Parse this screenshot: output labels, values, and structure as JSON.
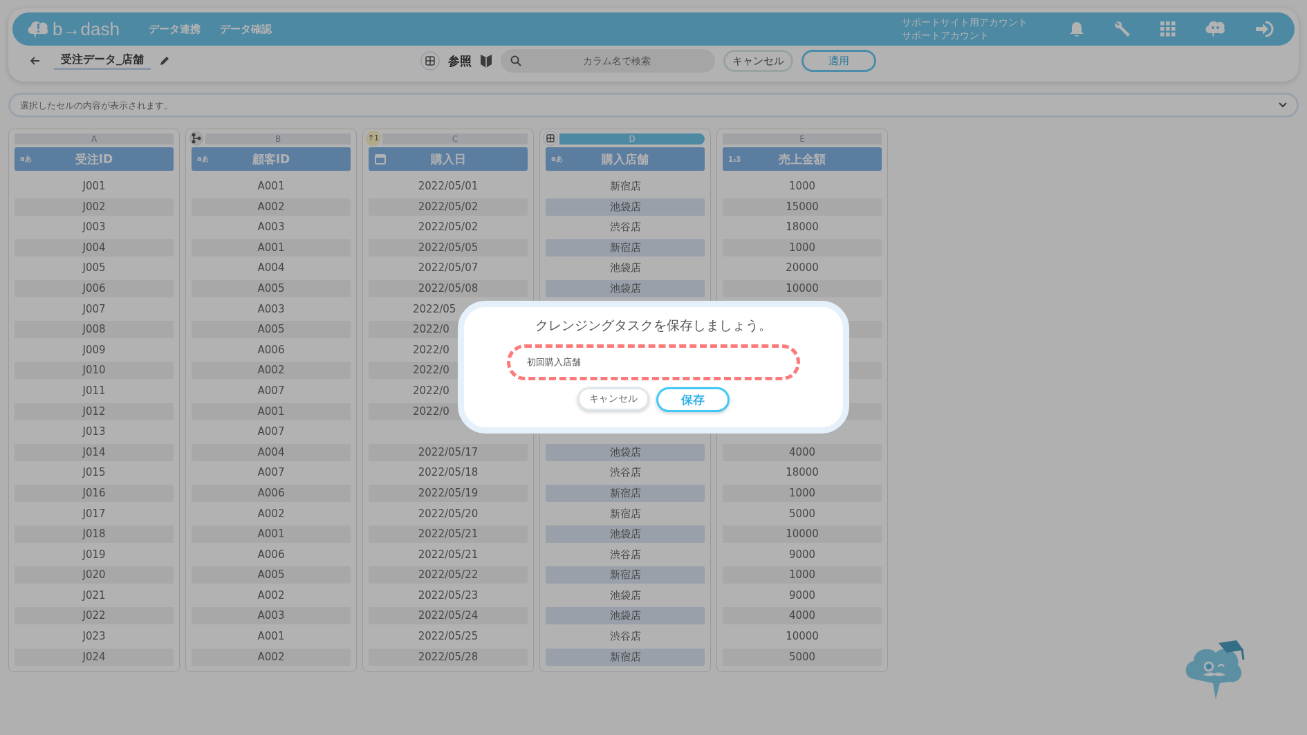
{
  "header": {
    "logo": "b→dash",
    "nav": [
      "データ連携",
      "データ確認"
    ],
    "account": [
      "サポートサイト用アカウント",
      "サポートアカウント"
    ]
  },
  "toolbar": {
    "title": "受注データ_店舗",
    "view_label": "参照",
    "search": {
      "placeholder": "カラム名で検索"
    },
    "cancel": "キャンセル",
    "apply": "適用"
  },
  "cell_bar": {
    "placeholder": "選択したセルの内容が表示されます。"
  },
  "columns": [
    {
      "letter": "A",
      "kind": "text",
      "type_label": "aあ",
      "title": "受注ID",
      "selected": false
    },
    {
      "letter": "B",
      "kind": "text",
      "type_label": "aあ",
      "title": "顧客ID",
      "selected": false,
      "badge": {
        "kind": "tree"
      }
    },
    {
      "letter": "C",
      "kind": "date",
      "title": "購入日",
      "selected": false,
      "badge": {
        "kind": "sort",
        "text": "↑1"
      }
    },
    {
      "letter": "D",
      "kind": "text",
      "type_label": "aあ",
      "title": "購入店舗",
      "selected": true,
      "badge": {
        "kind": "grid"
      }
    },
    {
      "letter": "E",
      "kind": "number",
      "type_label": "1₂3",
      "title": "売上金額",
      "selected": false
    }
  ],
  "rows": [
    [
      "J001",
      "A001",
      "2022/05/01",
      "新宿店",
      "1000"
    ],
    [
      "J002",
      "A002",
      "2022/05/02",
      "池袋店",
      "15000"
    ],
    [
      "J003",
      "A003",
      "2022/05/02",
      "渋谷店",
      "18000"
    ],
    [
      "J004",
      "A001",
      "2022/05/05",
      "新宿店",
      "1000"
    ],
    [
      "J005",
      "A004",
      "2022/05/07",
      "池袋店",
      "20000"
    ],
    [
      "J006",
      "A005",
      "2022/05/08",
      "池袋店",
      "10000"
    ],
    [
      "J007",
      "A003",
      "2022/05",
      null,
      null
    ],
    [
      "J008",
      "A005",
      "2022/0",
      null,
      null
    ],
    [
      "J009",
      "A006",
      "2022/0",
      null,
      null
    ],
    [
      "J010",
      "A002",
      "2022/0",
      null,
      null
    ],
    [
      "J011",
      "A007",
      "2022/0",
      null,
      null
    ],
    [
      "J012",
      "A001",
      "2022/0",
      null,
      null
    ],
    [
      "J013",
      "A007",
      null,
      null,
      null
    ],
    [
      "J014",
      "A004",
      "2022/05/17",
      "池袋店",
      "4000"
    ],
    [
      "J015",
      "A007",
      "2022/05/18",
      "渋谷店",
      "18000"
    ],
    [
      "J016",
      "A006",
      "2022/05/19",
      "新宿店",
      "1000"
    ],
    [
      "J017",
      "A002",
      "2022/05/20",
      "新宿店",
      "5000"
    ],
    [
      "J018",
      "A001",
      "2022/05/21",
      "池袋店",
      "10000"
    ],
    [
      "J019",
      "A006",
      "2022/05/21",
      "渋谷店",
      "9000"
    ],
    [
      "J020",
      "A005",
      "2022/05/22",
      "新宿店",
      "1000"
    ],
    [
      "J021",
      "A002",
      "2022/05/23",
      "池袋店",
      "9000"
    ],
    [
      "J022",
      "A003",
      "2022/05/24",
      "池袋店",
      "4000"
    ],
    [
      "J023",
      "A001",
      "2022/05/25",
      "渋谷店",
      "10000"
    ],
    [
      "J024",
      "A002",
      "2022/05/28",
      "新宿店",
      "5000"
    ]
  ],
  "dialog": {
    "title": "クレンジングタスクを保存しましょう。",
    "name_value": "初回購入店舗",
    "highlighted": true,
    "cancel": "キャンセル",
    "save": "保存"
  }
}
